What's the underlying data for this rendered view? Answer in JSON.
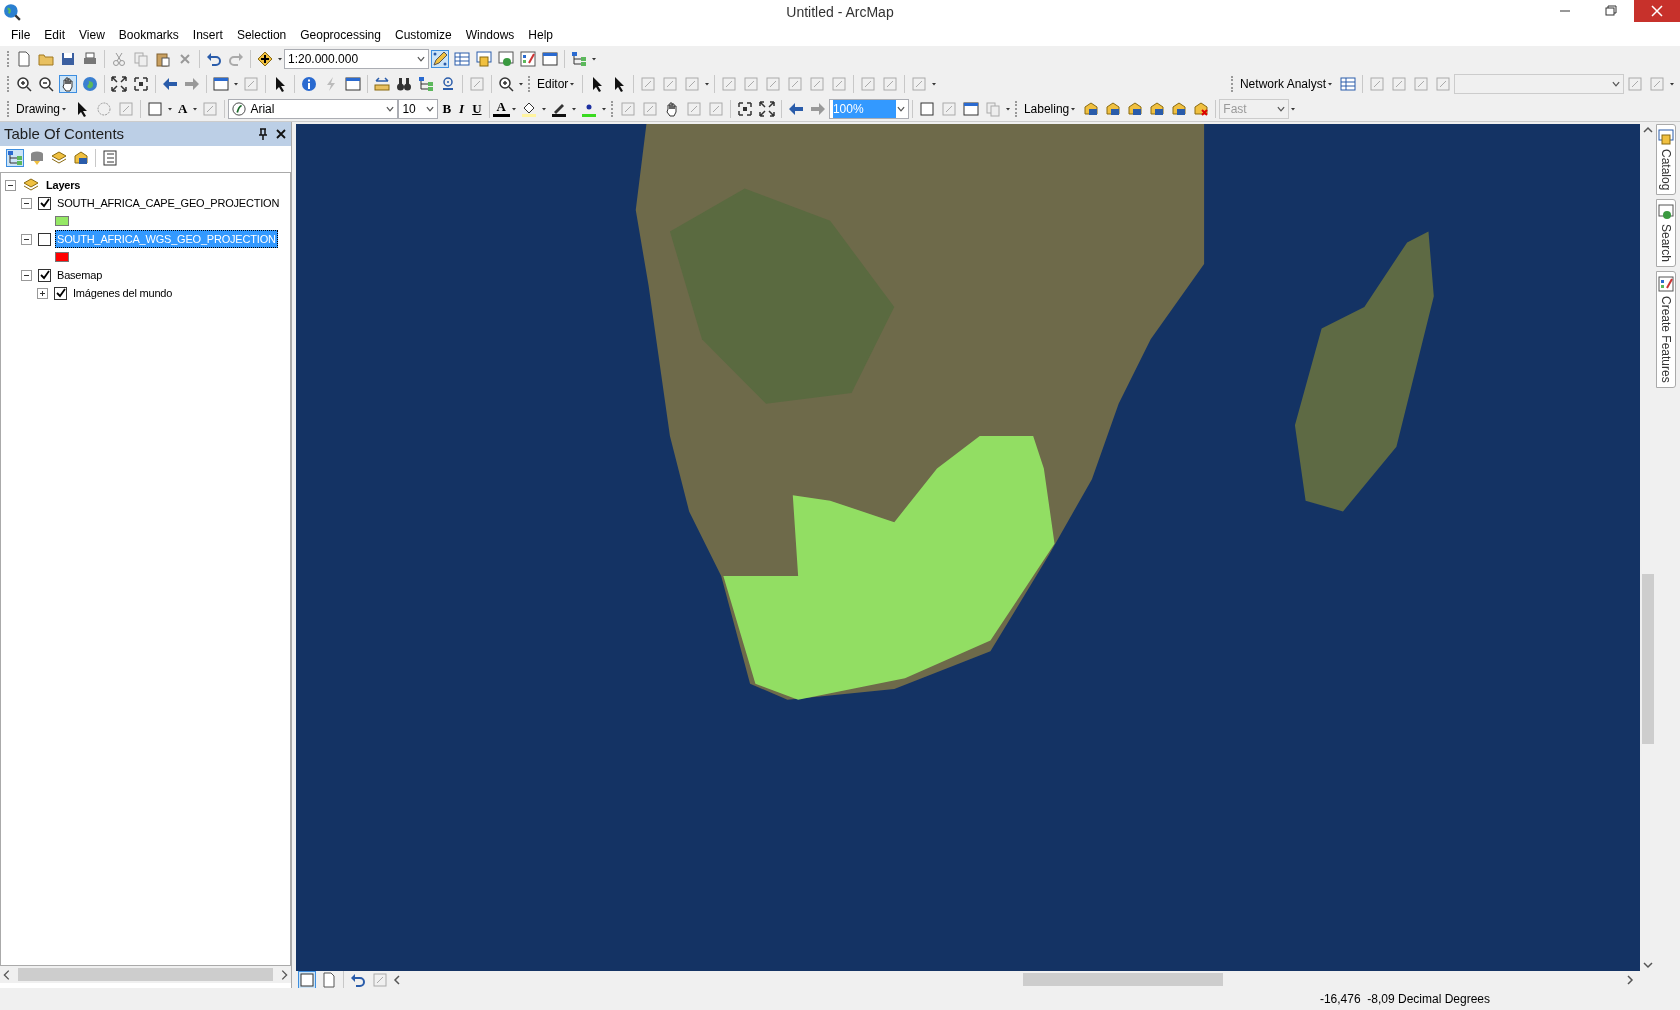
{
  "window": {
    "title": "Untitled - ArcMap"
  },
  "menu": [
    "File",
    "Edit",
    "View",
    "Bookmarks",
    "Insert",
    "Selection",
    "Geoprocessing",
    "Customize",
    "Windows",
    "Help"
  ],
  "toolbars": {
    "scale": "1:20.000.000",
    "editor": "Editor",
    "network_analyst": "Network Analyst",
    "drawing": "Drawing",
    "text_tool": "A",
    "font": "Arial",
    "font_size": "10",
    "format_buttons": [
      "B",
      "I",
      "U"
    ],
    "font_color": "A",
    "zoom_percent": "100%",
    "labeling": "Labeling",
    "label_quality": "Fast"
  },
  "toc": {
    "title": "Table Of Contents",
    "tree": [
      {
        "kind": "group",
        "label": "Layers",
        "expanded": true,
        "selected": false,
        "children": [
          {
            "kind": "layer",
            "label": "SOUTH_AFRICA_CAPE_GEO_PROJECTION",
            "checked": true,
            "expanded": true,
            "selected": false,
            "color": "#95e865"
          },
          {
            "kind": "layer",
            "label": "SOUTH_AFRICA_WGS_GEO_PROJECTION",
            "checked": false,
            "expanded": true,
            "selected": true,
            "color": "#ff0000"
          },
          {
            "kind": "layer",
            "label": "Basemap",
            "checked": true,
            "expanded": true,
            "selected": false,
            "children": [
              {
                "kind": "layer",
                "label": "Imágenes del mundo",
                "checked": true,
                "expanded": false,
                "selected": false
              }
            ]
          }
        ]
      }
    ]
  },
  "dock_tabs": [
    "Catalog",
    "Search",
    "Create Features"
  ],
  "status_bar": {
    "coordinates": "-16,476  -8,09 Decimal Degrees"
  }
}
